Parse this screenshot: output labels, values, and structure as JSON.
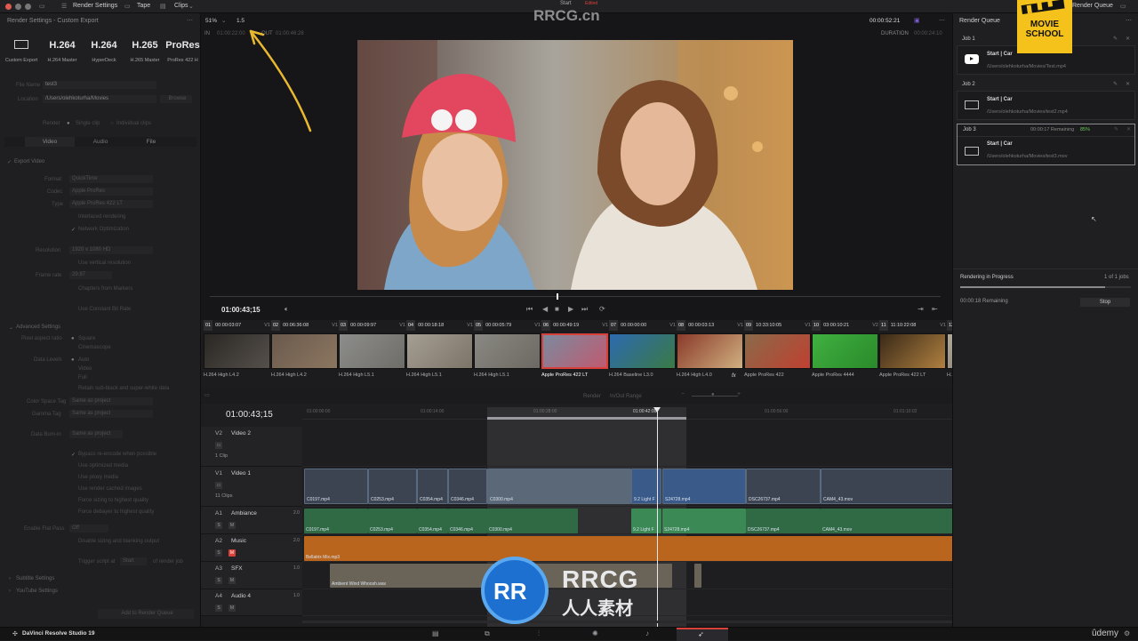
{
  "topbar": {
    "render_settings": "Render Settings",
    "tape": "Tape",
    "clips": "Clips",
    "center_title": "Start",
    "center_sub": "Edited",
    "render_queue_btn": "Render Queue"
  },
  "left_panel": {
    "title": "Render Settings - Custom Export",
    "presets": [
      {
        "big": "",
        "small": "Custom Export"
      },
      {
        "big": "H.264",
        "small": "H.264 Master"
      },
      {
        "big": "H.264",
        "small": "HyperDeck"
      },
      {
        "big": "H.265",
        "small": "H.265 Master"
      },
      {
        "big": "ProRes",
        "small": "ProRes 422 H"
      }
    ],
    "file_name_label": "File Name",
    "file_name": "test3",
    "location_label": "Location",
    "location": "/Users/olehkoturha/Movies",
    "browse": "Browse",
    "render_label": "Render",
    "single_clip": "Single clip",
    "individual_clips": "Individual clips",
    "tabs": [
      "Video",
      "Audio",
      "File"
    ],
    "export_video": "Export Video",
    "format_label": "Format",
    "format": "QuickTime",
    "codec_label": "Codec",
    "codec": "Apple ProRes",
    "type_label": "Type",
    "type": "Apple ProRes 422 LT",
    "interlaced": "Interlaced rendering",
    "network_opt": "Network Optimization",
    "resolution_label": "Resolution",
    "resolution": "1920 x 1080 HD",
    "vertical_res": "Use vertical resolution",
    "frame_rate_label": "Frame rate",
    "frame_rate": "29.97",
    "chapters": "Chapters from Markers",
    "constant_bitrate": "Use Constant Bit Rate",
    "advanced": "Advanced Settings",
    "pixel_aspect_label": "Pixel aspect ratio",
    "square": "Square",
    "cinemascope": "Cinemascope",
    "data_levels_label": "Data Levels",
    "auto": "Auto",
    "video": "Video",
    "full": "Full",
    "retain": "Retain sub-black and super-white data",
    "color_space_label": "Color Space Tag",
    "color_space": "Same as project",
    "gamma_label": "Gamma Tag",
    "gamma": "Same as project",
    "data_burnin_label": "Data Burn-in",
    "data_burnin": "Same as project",
    "bypass": "Bypass re-encode when possible",
    "optimized": "Use optimized media",
    "proxy": "Use proxy media",
    "cached": "Use render cached images",
    "force_sizing": "Force sizing to highest quality",
    "force_debayer": "Force debayer to highest quality",
    "flat_pass_label": "Enable Flat Pass",
    "flat_pass": "Off",
    "disable_sizing": "Disable sizing and blanking output",
    "trigger": "Trigger script at",
    "trigger_val": "Start",
    "of_render_job": "of render job",
    "subtitle": "Subtitle Settings",
    "youtube": "YouTube Settings",
    "add_to_queue": "Add to Render Queue"
  },
  "viewer": {
    "zoom": "51%",
    "speed": "1.5",
    "in_label": "IN",
    "in_time": "01:00:22:00",
    "out_label": "OUT",
    "out_time": "01:00:46:28",
    "timecode_top": "00:00:52:21",
    "duration_label": "DURATION",
    "duration": "00:00:24:10",
    "current_tc": "01:00:43;15"
  },
  "media_clips": [
    {
      "num": "01",
      "tc": "00:00:03:07",
      "track": "V1",
      "label": "H.264 High L4.2",
      "c1": "#2a2724",
      "c2": "#55504a"
    },
    {
      "num": "02",
      "tc": "00:06:36:08",
      "track": "V1",
      "label": "H.264 High L4.2",
      "c1": "#6a5a4d",
      "c2": "#8c7660"
    },
    {
      "num": "03",
      "tc": "00:00:09:97",
      "track": "V1",
      "label": "H.264 High L5.1",
      "c1": "#8d8d8b",
      "c2": "#6e6d68"
    },
    {
      "num": "04",
      "tc": "00:00:18:18",
      "track": "V1",
      "label": "H.264 High L5.1",
      "c1": "#a59e92",
      "c2": "#7d7468"
    },
    {
      "num": "05",
      "tc": "00:00:05:79",
      "track": "V1",
      "label": "H.264 High L5.1",
      "c1": "#8a8882",
      "c2": "#6c6962"
    },
    {
      "num": "06",
      "tc": "00:00:49:19",
      "track": "V1",
      "label": "Apple ProRes 422 LT",
      "c1": "#7b8a9e",
      "c2": "#c05a70"
    },
    {
      "num": "07",
      "tc": "00:00:00:00",
      "track": "V1",
      "label": "H.264 Baseline L3.0",
      "c1": "#2d6ab0",
      "c2": "#3a7a45"
    },
    {
      "num": "08",
      "tc": "00:00:03:13",
      "track": "V1",
      "label": "H.264 High L4.0",
      "c1": "#8a3a2a",
      "c2": "#d0b080"
    },
    {
      "num": "09",
      "tc": "10:33:10:05",
      "track": "V1",
      "label": "Apple ProRes 422",
      "c1": "#8a6a4a",
      "c2": "#c04030"
    },
    {
      "num": "10",
      "tc": "03:00:10:21",
      "track": "V2",
      "label": "Apple ProRes 4444",
      "c1": "#40b040",
      "c2": "#2a8a2a"
    },
    {
      "num": "11",
      "tc": "11:10:22:08",
      "track": "V1",
      "label": "Apple ProRes 422 LT",
      "c1": "#3a2a18",
      "c2": "#b08040"
    },
    {
      "num": "12",
      "tc": "00:00:38:53",
      "track": "V1",
      "label": "H.264 High L4.2",
      "c1": "#b0a898",
      "c2": "#706a60"
    }
  ],
  "timeline": {
    "timecode": "01:00:43;15",
    "render_label": "Render",
    "render_range": "In/Out Range",
    "ruler": [
      "01:00:00:00",
      "01:00:14:00",
      "01:00:28:00",
      "01:00:42:00",
      "01:00:56:00",
      "01:01:10:02",
      "01:01:24:02"
    ],
    "tracks": [
      {
        "id": "V2",
        "name": "Video 2",
        "sub": "1 Clip"
      },
      {
        "id": "V1",
        "name": "Video 1",
        "sub": "11 Clips"
      },
      {
        "id": "A1",
        "name": "Ambiance",
        "vol": "2.0"
      },
      {
        "id": "A2",
        "name": "Music",
        "vol": "2.0"
      },
      {
        "id": "A3",
        "name": "SFX",
        "vol": "1.0"
      },
      {
        "id": "A4",
        "name": "Audio 4",
        "vol": "1.0"
      }
    ],
    "v1_clips": [
      "C0197.mp4",
      "C0253.mp4",
      "C0354.mp4",
      "C0346.mp4",
      "C0300.mp4",
      "9.2 Light F",
      "S24728.mp4",
      "DSC26737.mp4",
      "CAM4_43.mov",
      "A005_C028...",
      "DJI_0002.mp4"
    ],
    "v2_clip": "A001C...",
    "a1_clips": [
      "C0197.mp4",
      "C0253.mp4",
      "C0354.mp4",
      "C0346.mp4",
      "C0300.mp4",
      "9.2 Light F",
      "S24728.mp4",
      "DSC26737.mp4",
      "CAM4_43.mov"
    ],
    "a2_clip": "Bellatrix Mix.mp3",
    "a3_clip": "Ambient Wind Whoosh.wav",
    "s": "S",
    "m": "M"
  },
  "render_queue": {
    "title": "Render Queue",
    "jobs": [
      {
        "name": "Job 1",
        "title": "Start | Car",
        "path": "/Users/olehkoturha/Movies/Test.mp4",
        "remaining": "",
        "pct": ""
      },
      {
        "name": "Job 2",
        "title": "Start | Car",
        "path": "/Users/olehkoturha/Movies/test2.mp4",
        "remaining": "",
        "pct": ""
      },
      {
        "name": "Job 3",
        "title": "Start | Car",
        "path": "/Users/olehkoturha/Movies/test3.mov",
        "remaining": "00:00:17 Remaining",
        "pct": "85%"
      }
    ],
    "progress_label": "Rendering in Progress",
    "progress_count": "1 of 1 jobs",
    "progress_fraction": 0.85,
    "remaining": "00:00:18 Remaining",
    "stop": "Stop"
  },
  "bottombar": {
    "app_name": "DaVinci Resolve Studio 19",
    "udemy": "ûdemy"
  },
  "watermarks": {
    "rrcg_top": "RRCG.cn",
    "movie_school": "MOVIE SCHOOL",
    "rrcg_logo": "RRCG",
    "rrcg_cn": "人人素材"
  },
  "colors": {
    "accent": "#d9403a",
    "queue_active": "#8a8a90",
    "audio_green": "#2f6a45",
    "music_orange": "#b9651e"
  }
}
